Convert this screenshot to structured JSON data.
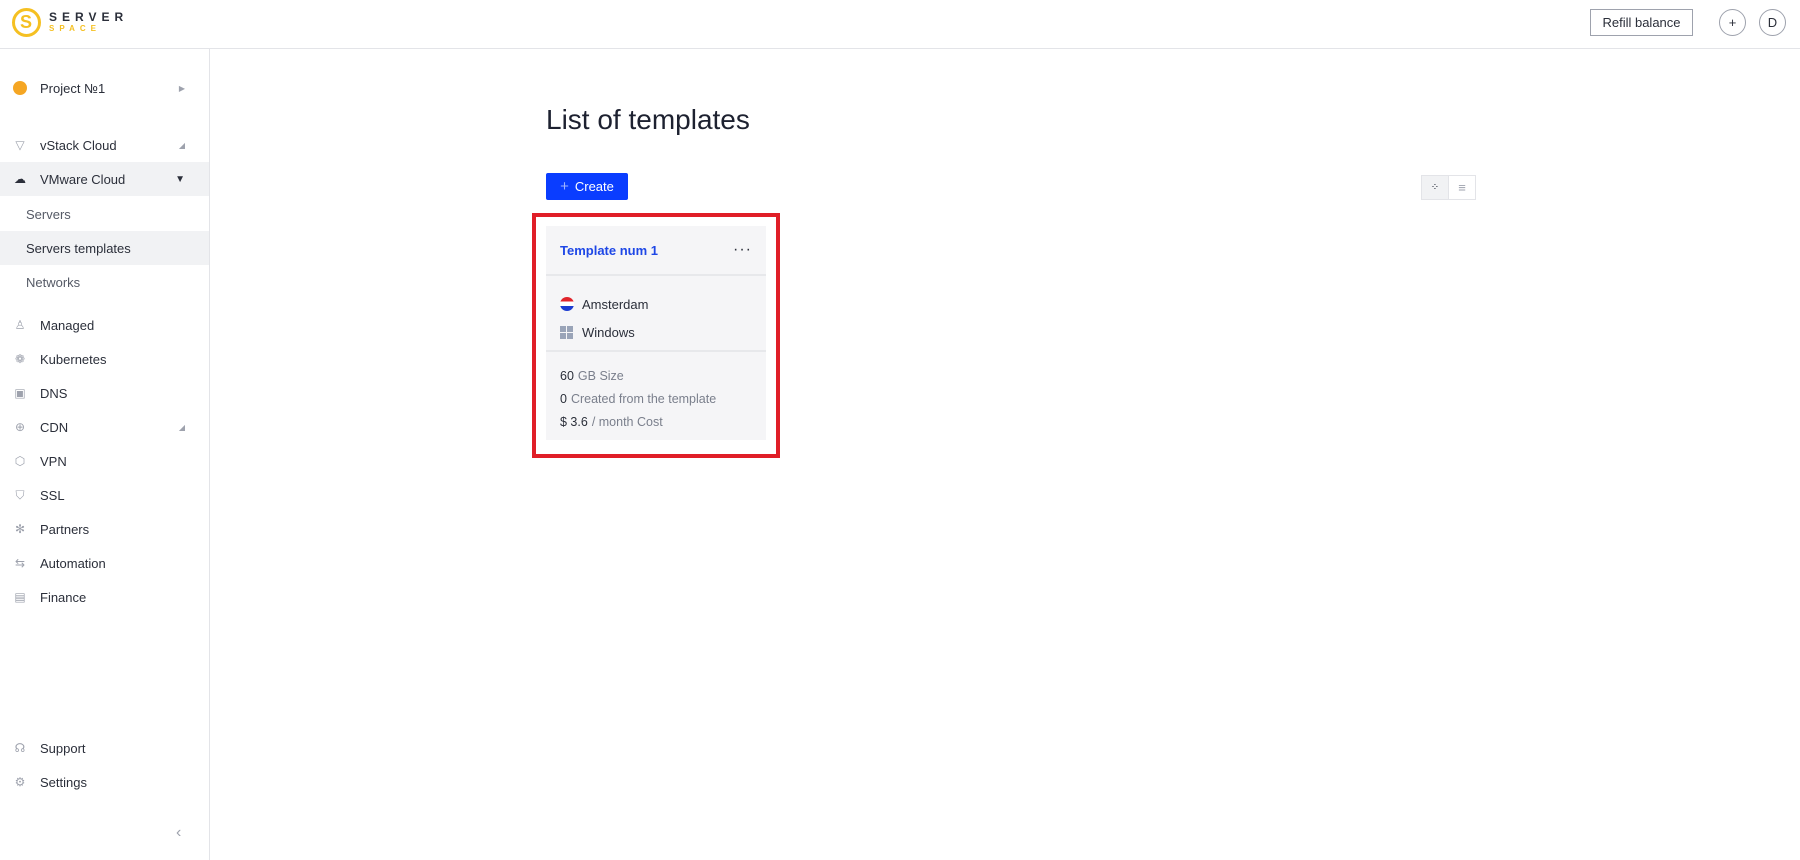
{
  "header": {
    "logo_line1": "SERVER",
    "logo_line2": "SPACE",
    "refill_label": "Refill balance",
    "add_icon": "+",
    "avatar_initial": "D"
  },
  "sidebar": {
    "project": "Project №1",
    "items": [
      {
        "label": "vStack Cloud",
        "icon": "vstack-icon"
      },
      {
        "label": "VMware Cloud",
        "icon": "cloud-icon"
      },
      {
        "label": "Managed",
        "icon": "managed-icon"
      },
      {
        "label": "Kubernetes",
        "icon": "kubernetes-icon"
      },
      {
        "label": "DNS",
        "icon": "dns-icon"
      },
      {
        "label": "CDN",
        "icon": "globe-icon"
      },
      {
        "label": "VPN",
        "icon": "vpn-icon"
      },
      {
        "label": "SSL",
        "icon": "shield-icon"
      },
      {
        "label": "Partners",
        "icon": "partners-icon"
      },
      {
        "label": "Automation",
        "icon": "automation-icon"
      },
      {
        "label": "Finance",
        "icon": "document-icon"
      }
    ],
    "sub_items": [
      {
        "label": "Servers"
      },
      {
        "label": "Servers templates"
      },
      {
        "label": "Networks"
      }
    ],
    "bottom": [
      {
        "label": "Support",
        "icon": "headset-icon"
      },
      {
        "label": "Settings",
        "icon": "gear-icon"
      }
    ]
  },
  "main": {
    "title": "List of templates",
    "create_label": "Create",
    "templates": [
      {
        "name": "Template num 1",
        "location": "Amsterdam",
        "os": "Windows",
        "size_value": "60",
        "size_label": "GB Size",
        "created_value": "0",
        "created_label": "Created from the template",
        "cost_value": "$ 3.6",
        "cost_label": "/ month Cost"
      }
    ]
  },
  "colors": {
    "accent": "#0a3dff",
    "brand": "#f5c022",
    "highlight": "#e01e27"
  }
}
